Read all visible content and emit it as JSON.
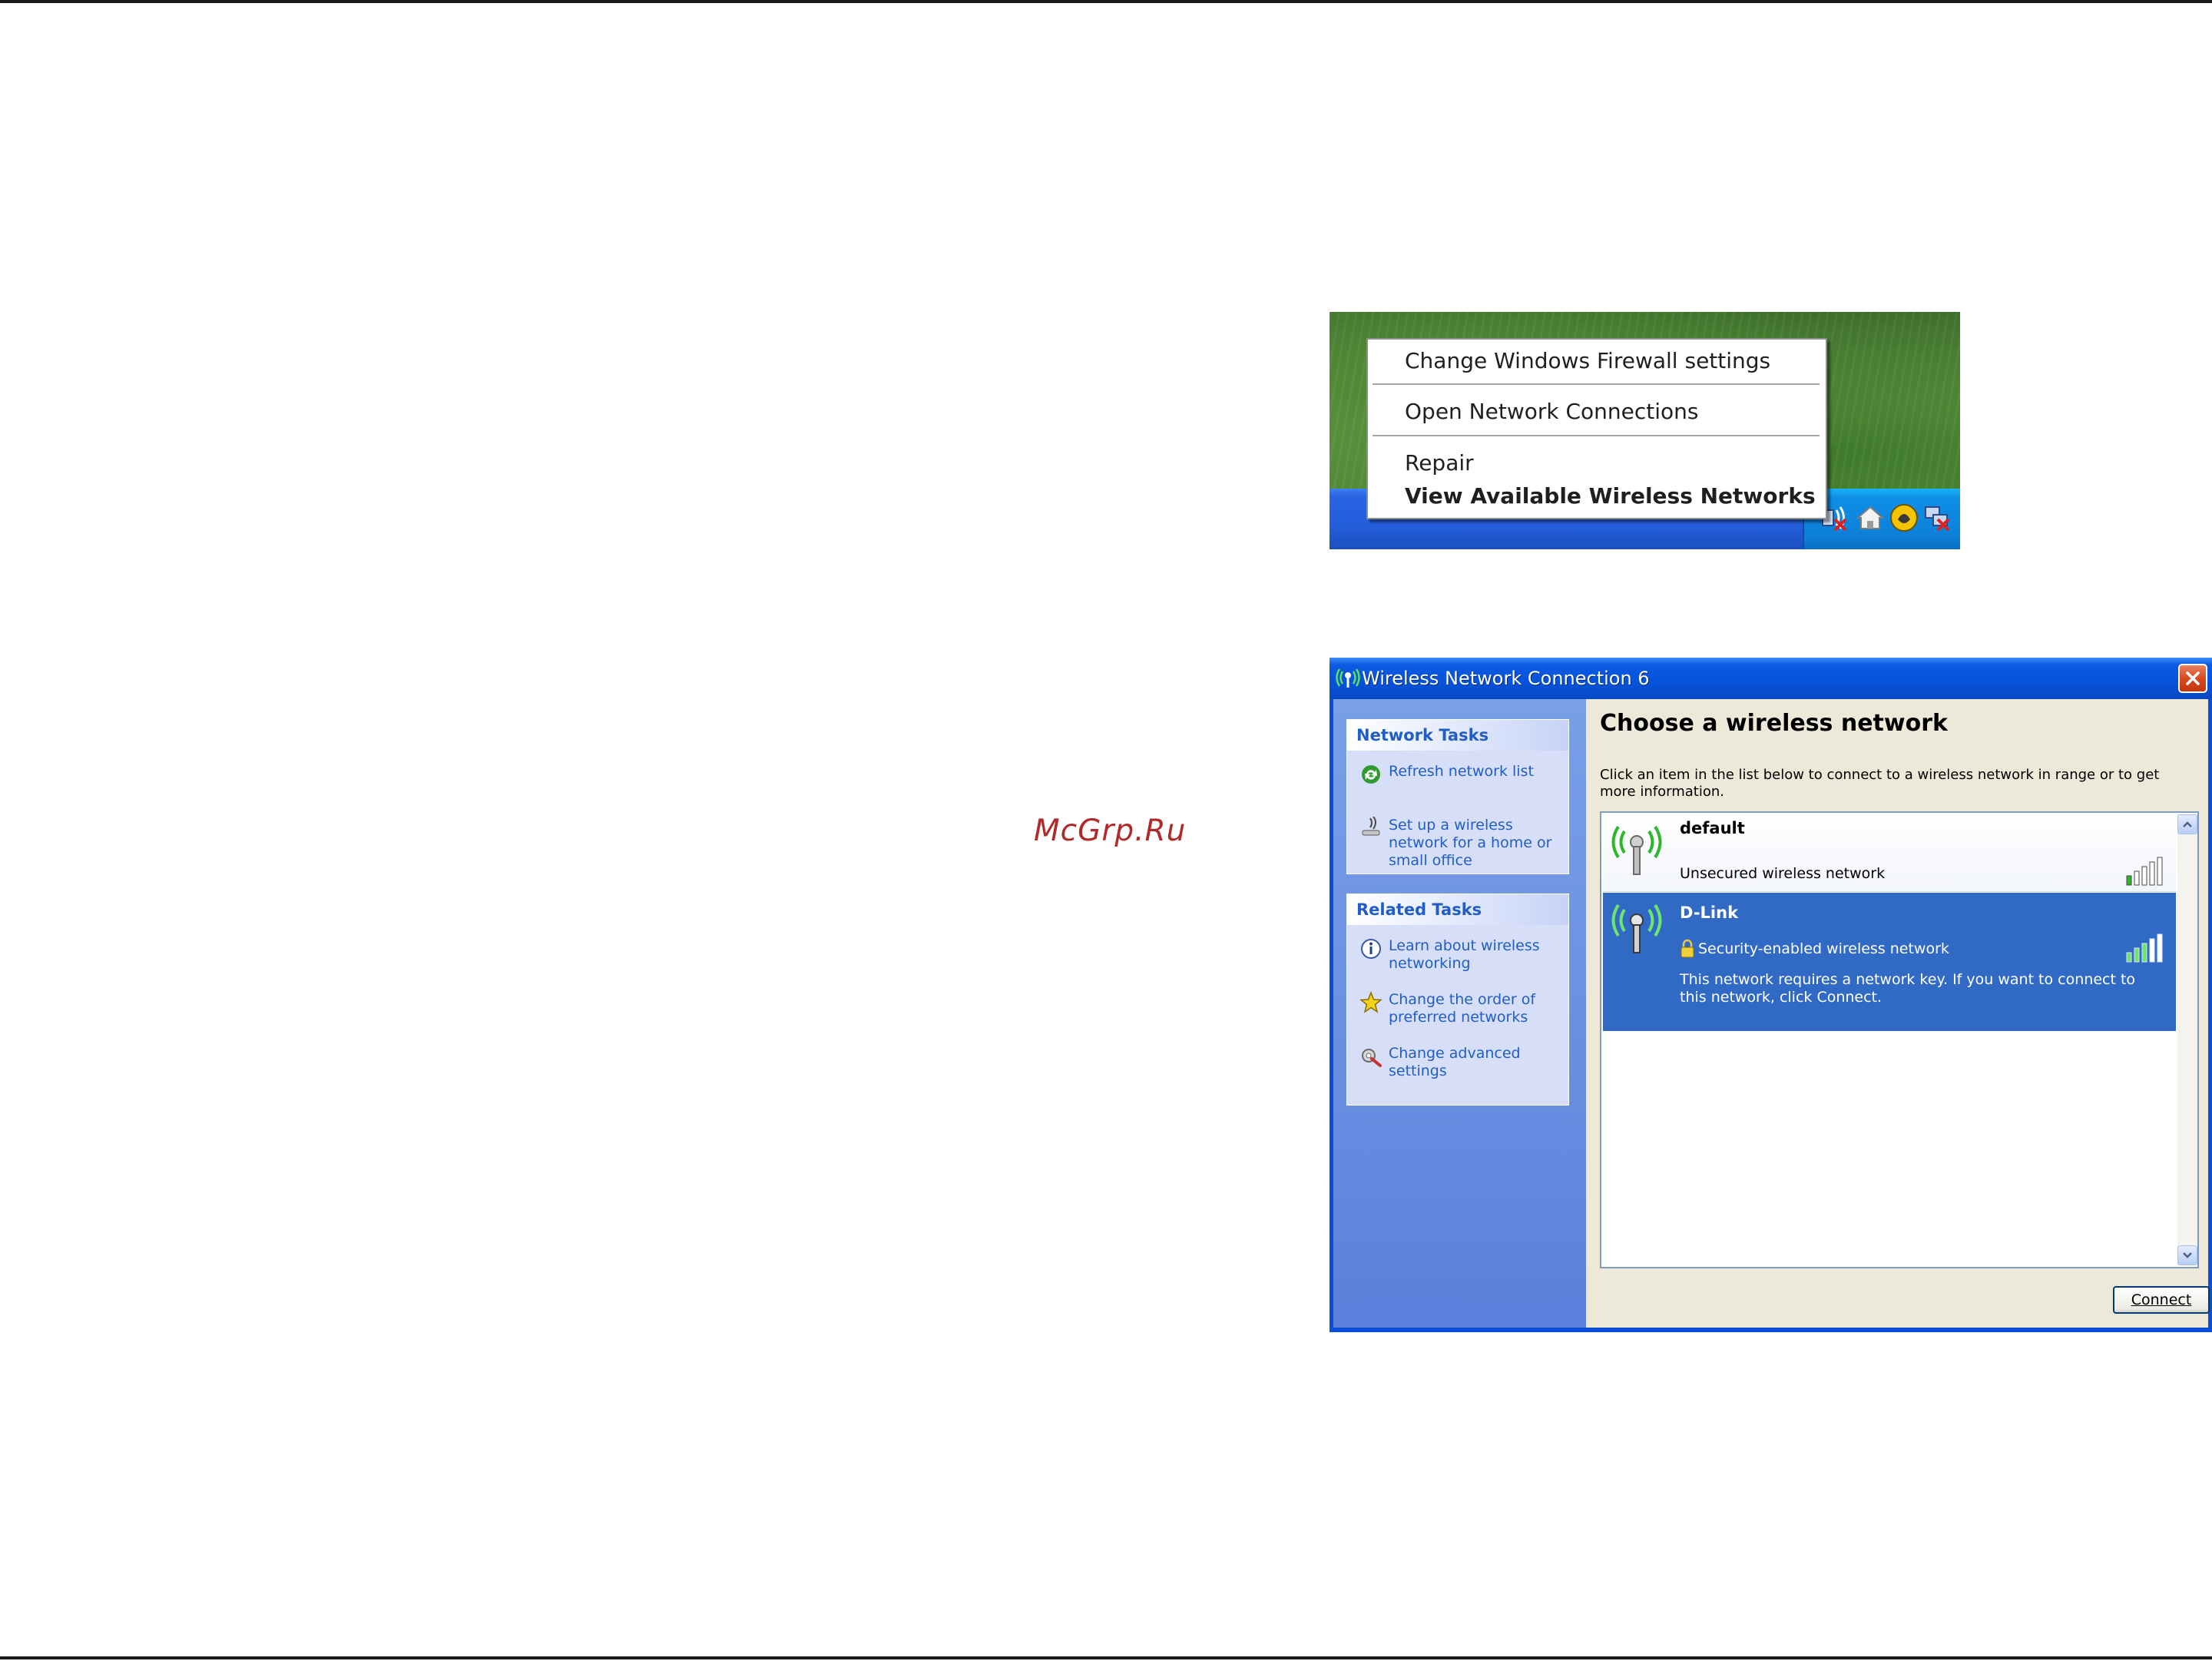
{
  "watermark": "McGrp.Ru",
  "tray_menu": {
    "items": [
      "Change Windows Firewall settings",
      "Open Network Connections",
      "Repair",
      "View Available Wireless Networks"
    ]
  },
  "dialog": {
    "title": "Wireless Network Connection 6",
    "network_tasks": {
      "header": "Network Tasks",
      "items": [
        {
          "label": "Refresh network list",
          "icon": "refresh-icon"
        },
        {
          "label": "Set up a wireless network for a home or small office",
          "icon": "wireless-setup-icon"
        }
      ]
    },
    "related_tasks": {
      "header": "Related Tasks",
      "items": [
        {
          "label": "Learn about wireless networking",
          "icon": "info-icon"
        },
        {
          "label": "Change the order of preferred networks",
          "icon": "star-icon"
        },
        {
          "label": "Change advanced settings",
          "icon": "settings-icon"
        }
      ]
    },
    "heading": "Choose a wireless network",
    "description": "Click an item in the list below to connect to a wireless network in range or to get more information.",
    "networks": [
      {
        "name": "default",
        "status": "Unsecured wireless network",
        "signal_bars": 1,
        "selected": false
      },
      {
        "name": "D-Link",
        "status": "Security-enabled wireless network",
        "note": "This network requires a network key. If you want to connect to this network, click Connect.",
        "signal_bars": 3,
        "selected": true
      }
    ],
    "connect_label": "Connect"
  },
  "colors": {
    "xp_title_blue": "#0654dc",
    "task_link": "#215dc6",
    "selection": "#316ac5",
    "watermark": "#b02a2a"
  }
}
